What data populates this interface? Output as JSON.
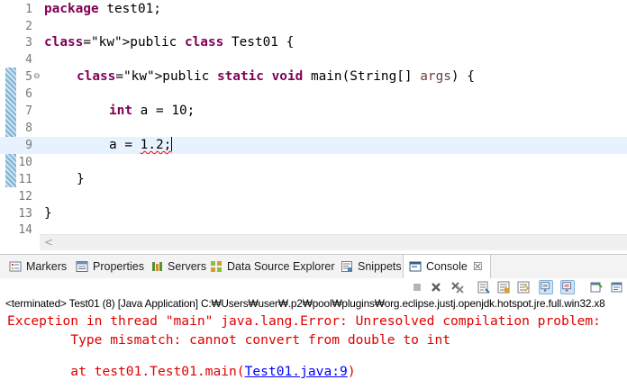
{
  "editor": {
    "lines": [
      {
        "num": "1",
        "code": "package test01;"
      },
      {
        "num": "2",
        "code": ""
      },
      {
        "num": "3",
        "code": "public class Test01 {"
      },
      {
        "num": "4",
        "code": ""
      },
      {
        "num": "5",
        "fold": "⊖",
        "code": "public static void main(String[] args) {"
      },
      {
        "num": "6",
        "code": ""
      },
      {
        "num": "7",
        "code": "int a = 10;"
      },
      {
        "num": "8",
        "code": ""
      },
      {
        "num": "9",
        "code": "a = 1.2;"
      },
      {
        "num": "10",
        "code": ""
      },
      {
        "num": "11",
        "code": "}"
      },
      {
        "num": "12",
        "code": ""
      },
      {
        "num": "13",
        "code": "}"
      },
      {
        "num": "14",
        "code": ""
      }
    ],
    "hscroll_left": "<"
  },
  "views": {
    "tabs": [
      {
        "label": "Markers",
        "icon": "markers-icon"
      },
      {
        "label": "Properties",
        "icon": "properties-icon"
      },
      {
        "label": "Servers",
        "icon": "servers-icon"
      },
      {
        "label": "Data Source Explorer",
        "icon": "data-source-icon"
      },
      {
        "label": "Snippets",
        "icon": "snippets-icon"
      },
      {
        "label": "Console",
        "icon": "console-icon",
        "active": true
      }
    ],
    "close_glyph": "☒"
  },
  "console": {
    "terminated": "<terminated> Test01 (8) [Java Application] C:₩Users₩user₩.p2₩pool₩plugins₩org.eclipse.justj.openjdk.hotspot.jre.full.win32.x8",
    "line1": "Exception in thread \"main\" java.lang.Error: Unresolved compilation problem: ",
    "line2": "\tType mismatch: cannot convert from double to int",
    "line3_prefix": "\tat test01.Test01.main(",
    "line3_link": "Test01.java:9",
    "line3_suffix": ")"
  },
  "colors": {
    "keyword": "#7f0055",
    "error_text": "#e00000",
    "link": "#0000ff",
    "current_line": "#e8f2fe"
  }
}
